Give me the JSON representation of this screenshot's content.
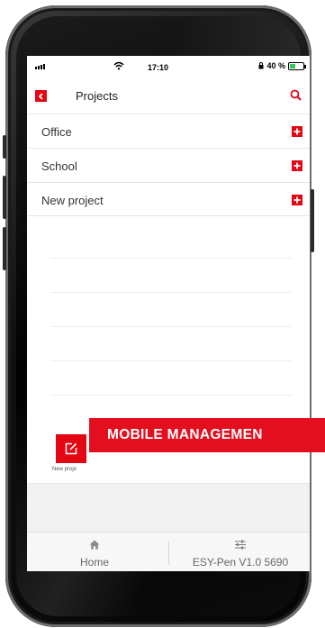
{
  "status_bar": {
    "time": "17:10",
    "battery_text": "40 %",
    "battery_level": 0.4
  },
  "header": {
    "title": "Projects",
    "back_icon": "chevron-left-icon",
    "search_icon": "search-icon"
  },
  "projects": [
    {
      "label": "Office"
    },
    {
      "label": "School"
    },
    {
      "label": "New project"
    }
  ],
  "fab": {
    "label": "New proje",
    "icon": "edit-icon"
  },
  "tabs": {
    "home": {
      "label": "Home",
      "icon": "home-icon"
    },
    "device": {
      "label": "ESY-Pen V1.0 5690",
      "icon": "sliders-icon"
    }
  },
  "banner": {
    "text": "MOBILE MANAGEMEN"
  },
  "colors": {
    "accent": "#e30613",
    "banner": "#e30f1f"
  }
}
